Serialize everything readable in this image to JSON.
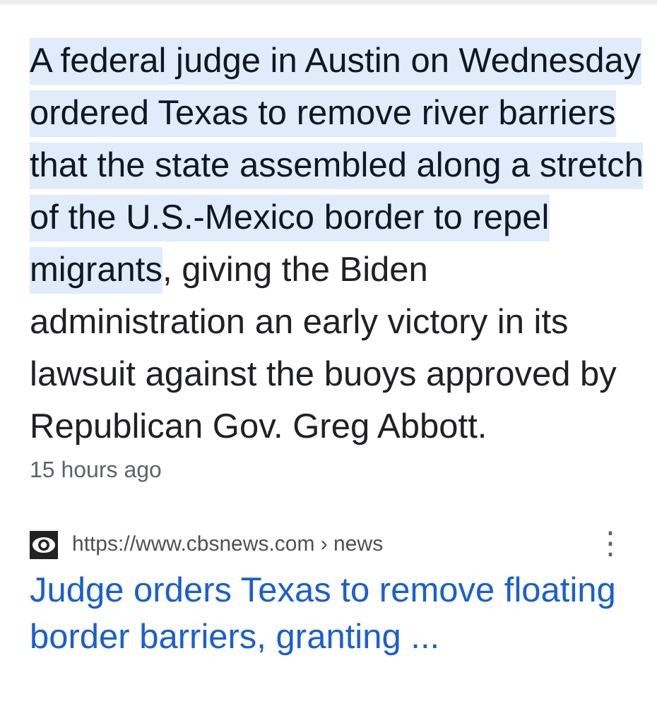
{
  "snippet": {
    "highlighted": "A federal judge in Austin on Wednesday ordered Texas to remove river barriers that the state assembled along a stretch of the U.S.-Mexico border to repel migrants",
    "text": ", giving the Biden administration an early victory in its lawsuit against the buoys approved by Republican Gov. Greg Abbott.",
    "time": "15 hours ago"
  },
  "result": {
    "url": "https://www.cbsnews.com › news",
    "menu": "⋮",
    "title": "Judge orders Texas to remove floating border barriers, granting ..."
  }
}
